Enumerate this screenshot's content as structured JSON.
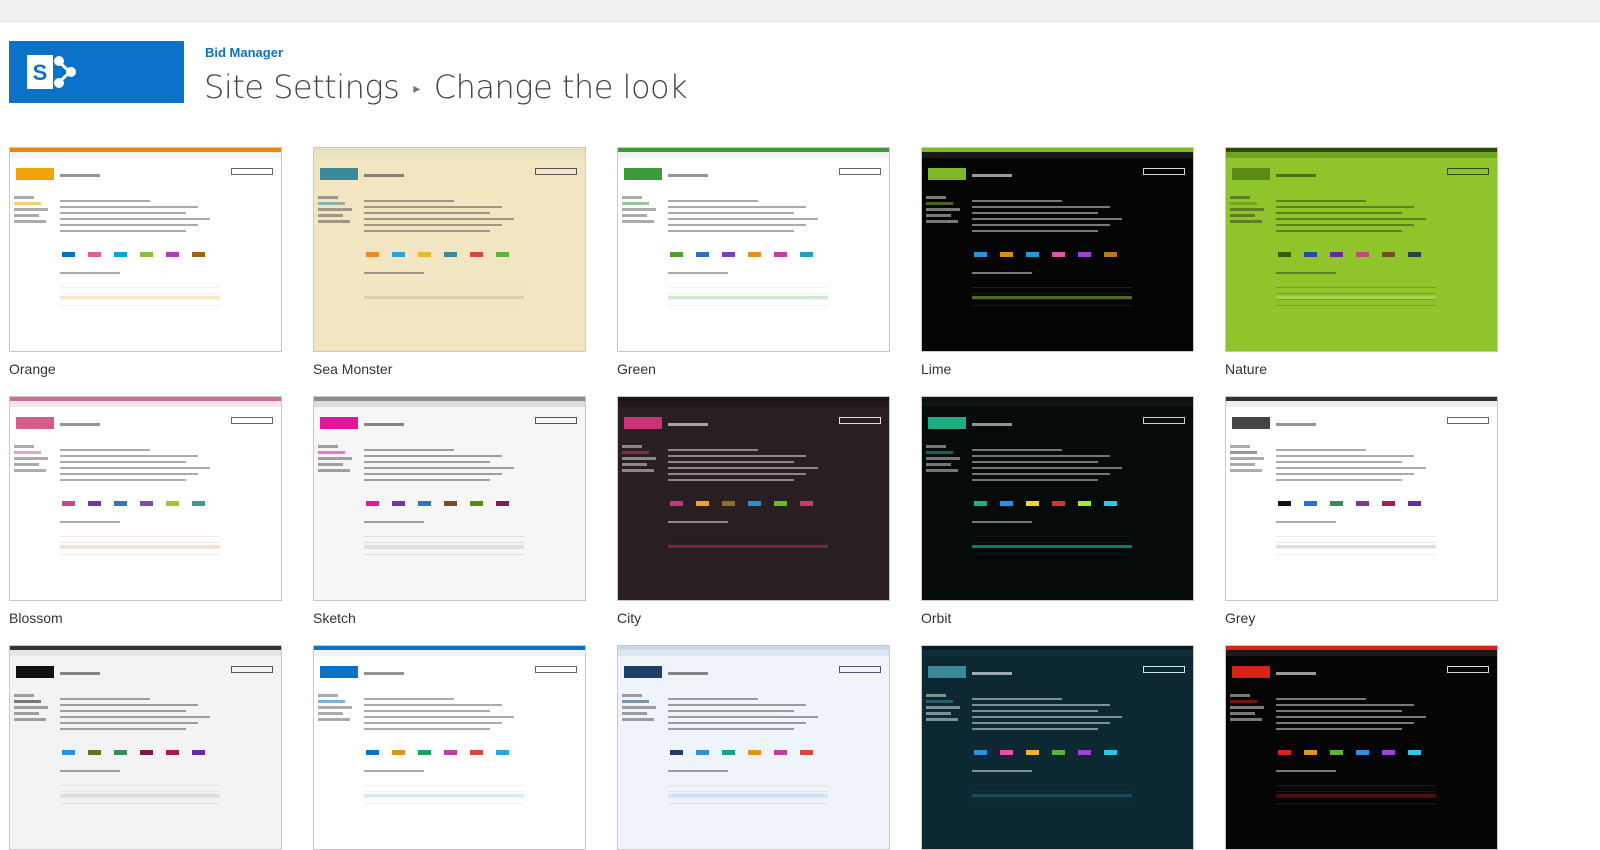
{
  "header": {
    "site_name": "Bid Manager",
    "crumb_parent": "Site Settings",
    "crumb_current": "Change the look",
    "logo_color": "#0a72c9"
  },
  "themes": [
    {
      "name": "Orange",
      "bg": "#ffffff",
      "text": "#666666",
      "suite": "#e8890c",
      "nav": "#f3f3f3",
      "accent": "#f0a30a",
      "hl": "#fde7c4",
      "swatches": [
        "#0072c6",
        "#e65c9c",
        "#00a3e0",
        "#8ebd3c",
        "#b03cbc",
        "#a3620e"
      ]
    },
    {
      "name": "Sea Monster",
      "bg": "#f2e6c2",
      "text": "#555555",
      "suite": "#e8e0c0",
      "nav": "#ece2be",
      "accent": "#3b8a9c",
      "hl": "#d7d3ad",
      "swatches": [
        "#e88a2a",
        "#2fa3d6",
        "#e8b92a",
        "#3b8a9c",
        "#d9473f",
        "#5fb33d"
      ]
    },
    {
      "name": "Green",
      "bg": "#ffffff",
      "text": "#666666",
      "suite": "#3c9a3c",
      "nav": "#f2f2f2",
      "accent": "#3c9a3c",
      "hl": "#cfeccf",
      "swatches": [
        "#4aa22a",
        "#2d6fc4",
        "#7b3fbc",
        "#e6911e",
        "#c03da8",
        "#1f9fb9"
      ]
    },
    {
      "name": "Lime",
      "bg": "#050505",
      "text": "#d8d8d8",
      "suite": "#7fb92a",
      "nav": "#1a1a1a",
      "accent": "#7fb92a",
      "hl": "#4f6b1f",
      "swatches": [
        "#2d8fe0",
        "#e48a12",
        "#1b9be0",
        "#e84fa8",
        "#a33fd9",
        "#b97a12"
      ]
    },
    {
      "name": "Nature",
      "bg": "#8fc42a",
      "text": "#314810",
      "suite": "#2e4a06",
      "nav": "#6ea51d",
      "accent": "#5a8a16",
      "hl": "#a9d34e",
      "swatches": [
        "#375a13",
        "#1e4ea8",
        "#6a2a9c",
        "#c44a7c",
        "#7a4a2a",
        "#2f3f46"
      ]
    },
    {
      "name": "Blossom",
      "bg": "#ffffff",
      "text": "#666666",
      "suite": "#d66a93",
      "nav": "#f7e4ec",
      "accent": "#d35c8a",
      "hl": "#f2e2c6",
      "swatches": [
        "#c84a82",
        "#6a3aa0",
        "#2b7ac0",
        "#7b4ea8",
        "#a4c13a",
        "#3b9e8a"
      ]
    },
    {
      "name": "Sketch",
      "bg": "#f6f6f6",
      "text": "#555555",
      "suite": "#8c8c8c",
      "nav": "#dcdcdc",
      "accent": "#e0189a",
      "hl": "#dedede",
      "swatches": [
        "#e0189a",
        "#6a3aa0",
        "#2b7ac0",
        "#7b4a2a",
        "#5a8a1a",
        "#8a1a4a"
      ]
    },
    {
      "name": "City",
      "bg": "#2a1f20",
      "text": "#dddddd",
      "suite": "#1a1516",
      "nav": "#231b1c",
      "accent": "#c8347a",
      "hl": "#7a2244",
      "swatches": [
        "#c8347a",
        "#e6a63a",
        "#8c6a3a",
        "#3a8ac8",
        "#6ab82a",
        "#c83a6a"
      ]
    },
    {
      "name": "Orbit",
      "bg": "#050a0a",
      "text": "#d0d0d0",
      "suite": "#111111",
      "nav": "#0c1414",
      "accent": "#1fae84",
      "hl": "#137a5f",
      "swatches": [
        "#1fae84",
        "#2d8fe0",
        "#e8d82a",
        "#c83a3a",
        "#a8e82a",
        "#2ac8e8"
      ]
    },
    {
      "name": "Grey",
      "bg": "#ffffff",
      "text": "#666666",
      "suite": "#333333",
      "nav": "#eeeeee",
      "accent": "#444444",
      "hl": "#dddddd",
      "swatches": [
        "#111111",
        "#2d6fc4",
        "#3a8a5a",
        "#7a3a8a",
        "#b01a4a",
        "#6a2aa0"
      ]
    },
    {
      "name": "",
      "bg": "#f3f3f3",
      "text": "#555555",
      "suite": "#333333",
      "nav": "#e6e6e6",
      "accent": "#111111",
      "hl": "#dddddd",
      "swatches": [
        "#2d8fe0",
        "#5a7a1a",
        "#3a8a5a",
        "#7a1a4a",
        "#b01a4a",
        "#6a2aa0"
      ]
    },
    {
      "name": "",
      "bg": "#ffffff",
      "text": "#666666",
      "suite": "#0a72c9",
      "nav": "#f2f2f2",
      "accent": "#0a72c9",
      "hl": "#d9e8f5",
      "swatches": [
        "#0a72c9",
        "#e6911e",
        "#1f9f5a",
        "#c03da8",
        "#d9473f",
        "#2fa3d6"
      ]
    },
    {
      "name": "",
      "bg": "#eef4fa",
      "text": "#555555",
      "suite": "#c9d9ea",
      "nav": "#dbe6f1",
      "accent": "#1f3f6a",
      "hl": "#cfe0ef",
      "swatches": [
        "#1f3f6a",
        "#2d8fe0",
        "#1f9f8a",
        "#e6911e",
        "#c03da8",
        "#d9473f"
      ]
    },
    {
      "name": "",
      "bg": "#0c2832",
      "text": "#d8e6ea",
      "suite": "#081c24",
      "nav": "#0e2f3a",
      "accent": "#3a8a9a",
      "hl": "#1a4a5a",
      "swatches": [
        "#2d8fe0",
        "#e84fa8",
        "#e8b92a",
        "#5fb33d",
        "#a33fd9",
        "#2ac8e8"
      ]
    },
    {
      "name": "",
      "bg": "#050505",
      "text": "#d8d8d8",
      "suite": "#d8231a",
      "nav": "#1a1a1a",
      "accent": "#d8231a",
      "hl": "#4a1010",
      "swatches": [
        "#d8231a",
        "#e6911e",
        "#5fb33d",
        "#2d8fe0",
        "#a33fd9",
        "#2ac8e8"
      ]
    }
  ]
}
